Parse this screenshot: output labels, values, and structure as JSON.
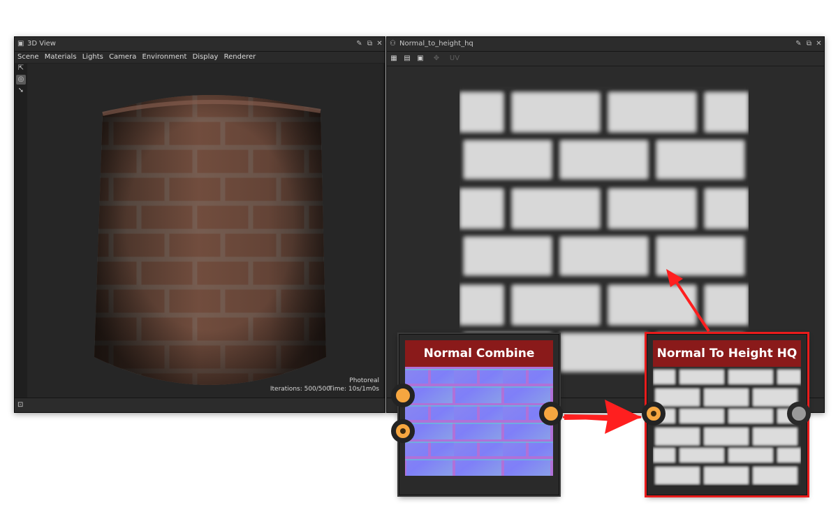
{
  "panel_3d": {
    "title": "3D View",
    "menu": [
      "Scene",
      "Materials",
      "Lights",
      "Camera",
      "Environment",
      "Display",
      "Renderer"
    ],
    "overlay": {
      "mode": "Photoreal",
      "iterations_label": "Iterations: 500/500",
      "time_label": "Time: 10s/1m0s"
    }
  },
  "panel_2d": {
    "title": "Normal_to_height_hq",
    "toolbar_uv_label": "UV"
  },
  "nodes": {
    "normal_combine": {
      "title": "Normal Combine"
    },
    "normal_to_height": {
      "title": "Normal To Height HQ"
    }
  },
  "colors": {
    "node_header": "#8a1a1a",
    "port": "#f6a640",
    "highlight": "#e81c1c",
    "arrow": "#ff1f1f"
  }
}
